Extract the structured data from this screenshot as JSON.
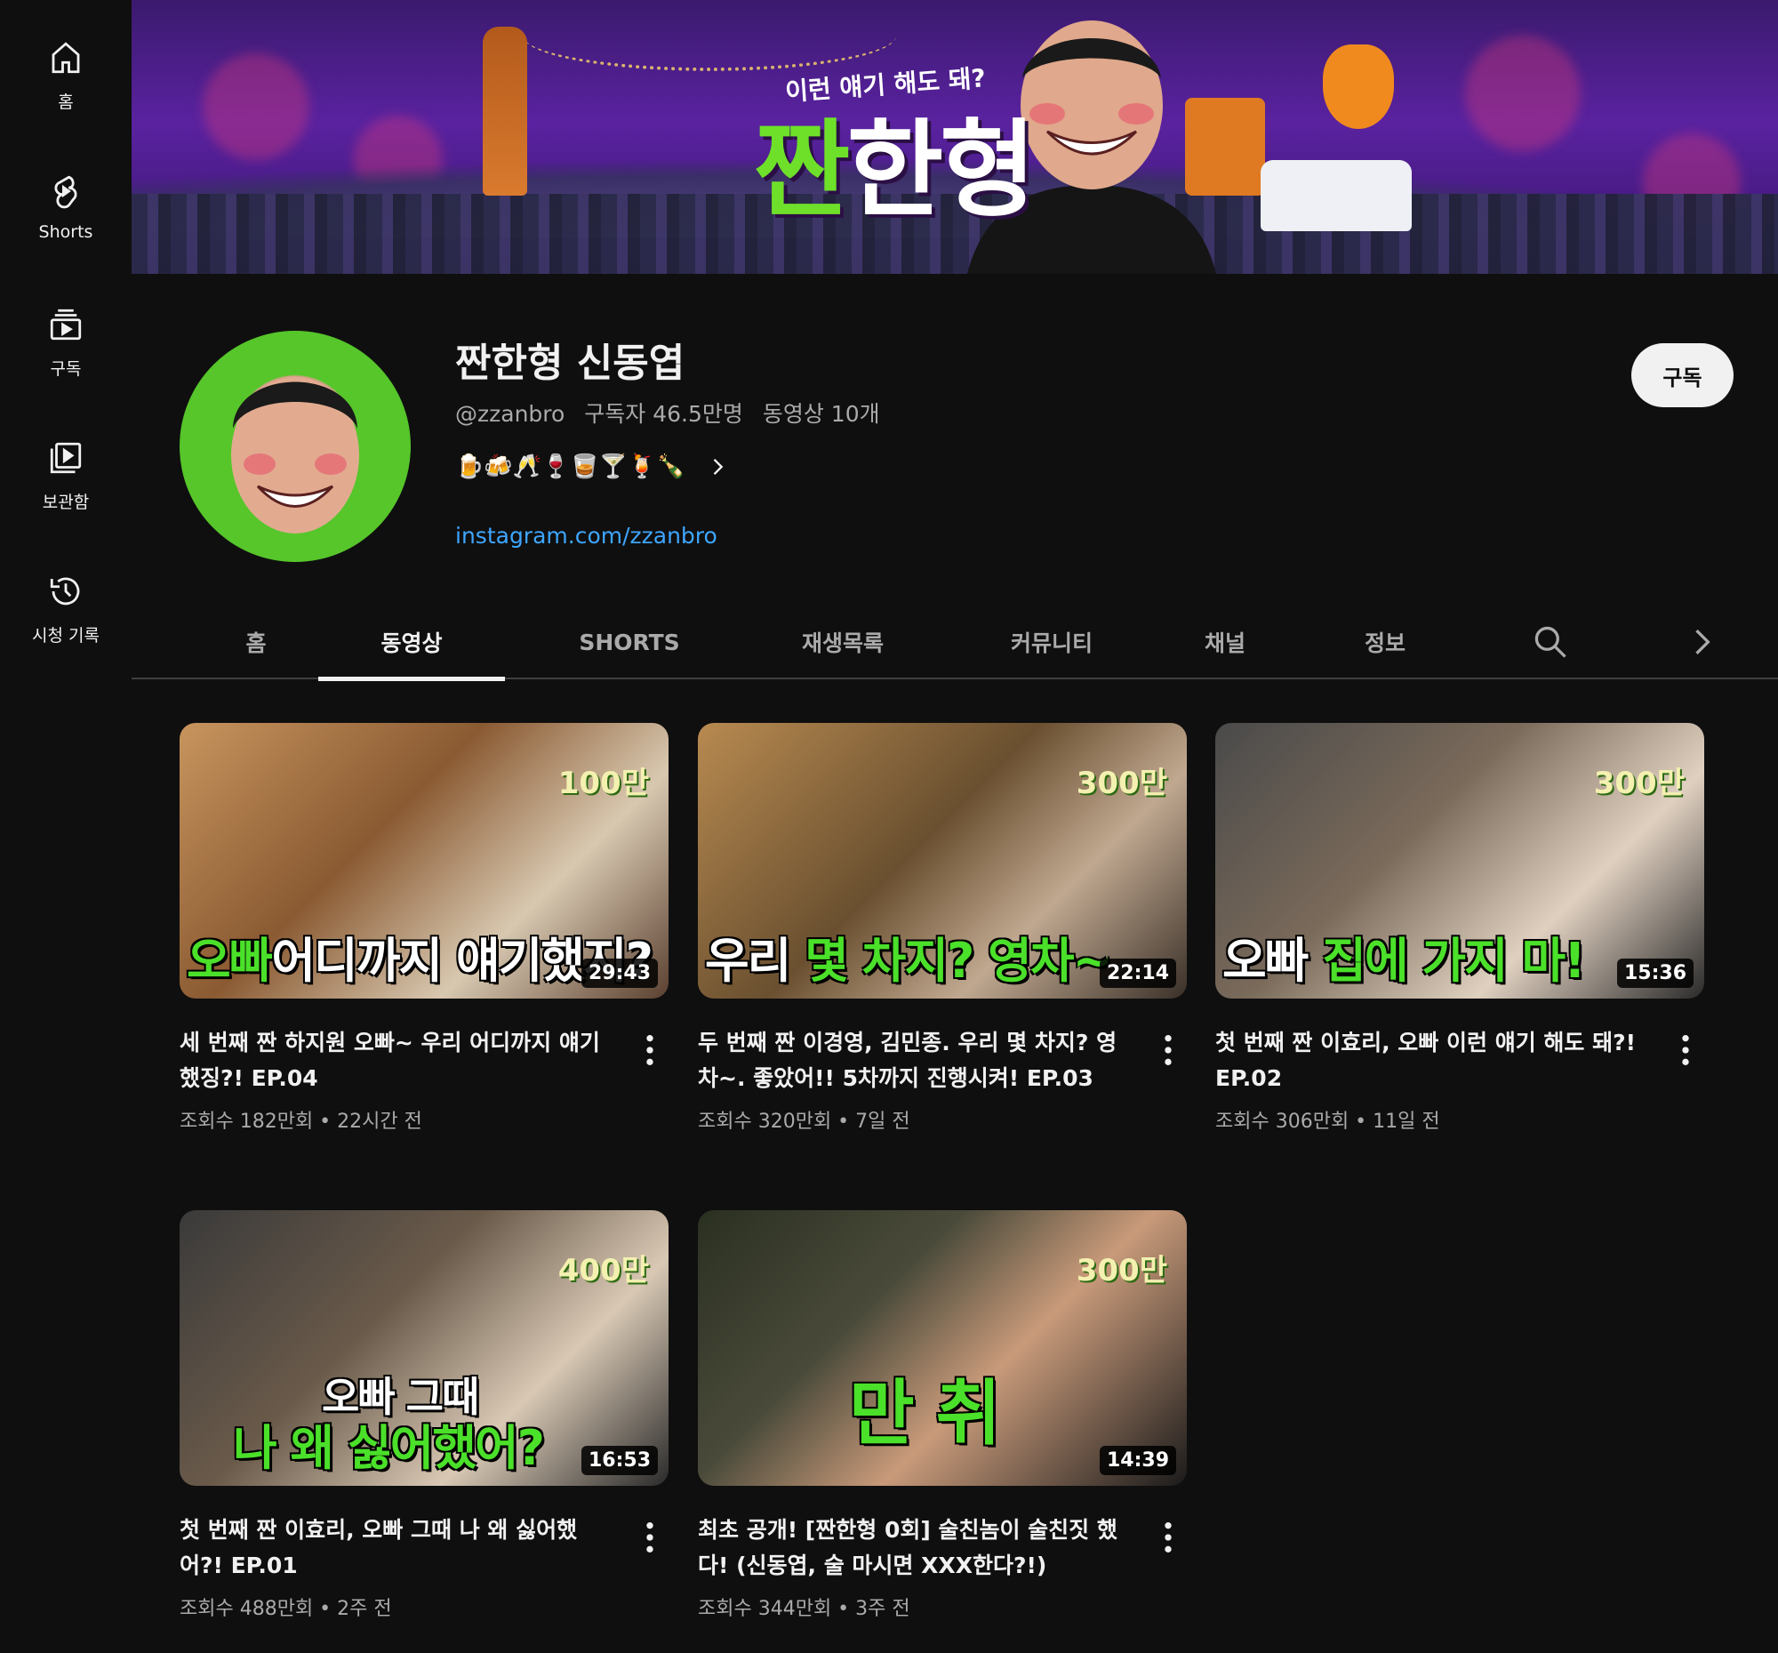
{
  "sidebar": {
    "items": [
      {
        "label": "홈",
        "icon": "home-icon"
      },
      {
        "label": "Shorts",
        "icon": "shorts-icon"
      },
      {
        "label": "구독",
        "icon": "subscriptions-icon"
      },
      {
        "label": "보관함",
        "icon": "library-icon"
      },
      {
        "label": "시청 기록",
        "icon": "history-icon"
      }
    ]
  },
  "banner": {
    "tagline": "이런 얘기 해도 돼?",
    "logo_accent": "짠",
    "logo_rest": "한형"
  },
  "channel": {
    "name": "짠한형 신동엽",
    "handle": "@zzanbro",
    "subscribers": "구독자 46.5만명",
    "video_count": "동영상 10개",
    "emojis": "🍺🍻🥂🍷🥃🍸🍹🍾",
    "link": "instagram.com/zzanbro",
    "subscribe_label": "구독"
  },
  "tabs": [
    {
      "label": "홈"
    },
    {
      "label": "동영상"
    },
    {
      "label": "SHORTS"
    },
    {
      "label": "재생목록"
    },
    {
      "label": "커뮤니티"
    },
    {
      "label": "채널"
    },
    {
      "label": "정보"
    }
  ],
  "active_tab": "동영상",
  "videos": [
    {
      "title": "세 번째 짠 하지원 오빠~ 우리 어디까지 얘기했징?! EP.04",
      "views": "조회수 182만회",
      "age": "22시간 전",
      "duration": "29:43",
      "thumb_caption_green": "오빠",
      "thumb_caption_white": "어디까지 얘기했지?",
      "thumb_badge": "100만"
    },
    {
      "title": "두 번째 짠 이경영, 김민종. 우리 몇 차지? 영차~. 좋았어!! 5차까지 진행시켜! EP.03",
      "views": "조회수 320만회",
      "age": "7일 전",
      "duration": "22:14",
      "thumb_caption_green": "우리",
      "thumb_caption_white": "몇 차지? 영차~",
      "thumb_badge": "300만"
    },
    {
      "title": "첫 번째 짠 이효리, 오빠 이런 얘기 해도 돼?! EP.02",
      "views": "조회수 306만회",
      "age": "11일 전",
      "duration": "15:36",
      "thumb_caption_green": "오빠",
      "thumb_caption_white": "집에 가지 마!",
      "thumb_badge": "300만"
    },
    {
      "title": "첫 번째 짠 이효리, 오빠 그때 나 왜 싫어했어?! EP.01",
      "views": "조회수 488만회",
      "age": "2주 전",
      "duration": "16:53",
      "thumb_caption_green": "오빠 그때",
      "thumb_caption_white": "나 왜 싫어했어?",
      "thumb_badge": "400만"
    },
    {
      "title": "최초 공개! [짠한형 0회] 술친놈이 술친짓 했다! (신동엽, 술 마시면 XXX한다?!)",
      "views": "조회수 344만회",
      "age": "3주 전",
      "duration": "14:39",
      "thumb_caption_green": "만 취",
      "thumb_caption_white": "",
      "thumb_badge": "300만"
    }
  ],
  "colors": {
    "background": "#0f0f0f",
    "text": "#f1f1f1",
    "secondary_text": "#aaaaaa",
    "link": "#3ea6ff",
    "accent_green": "#4be02a"
  }
}
